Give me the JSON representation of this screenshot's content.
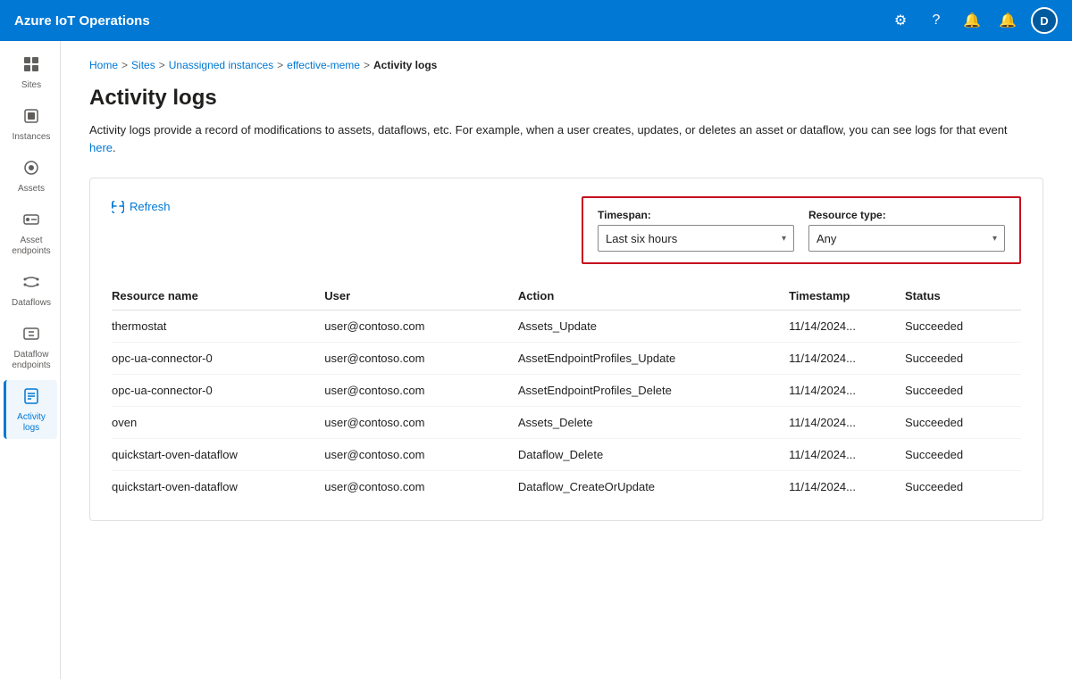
{
  "app": {
    "title": "Azure IoT Operations"
  },
  "topnav": {
    "title": "Azure IoT Operations",
    "avatar_label": "D"
  },
  "sidebar": {
    "items": [
      {
        "id": "sites",
        "label": "Sites",
        "icon": "⊞",
        "active": false
      },
      {
        "id": "instances",
        "label": "Instances",
        "icon": "⬡",
        "active": false
      },
      {
        "id": "assets",
        "label": "Assets",
        "icon": "◧",
        "active": false
      },
      {
        "id": "asset-endpoints",
        "label": "Asset endpoints",
        "icon": "⬡",
        "active": false
      },
      {
        "id": "dataflows",
        "label": "Dataflows",
        "icon": "⇄",
        "active": false
      },
      {
        "id": "dataflow-endpoints",
        "label": "Dataflow endpoints",
        "icon": "⊡",
        "active": false
      },
      {
        "id": "activity-logs",
        "label": "Activity logs",
        "icon": "📋",
        "active": true
      }
    ]
  },
  "breadcrumb": {
    "items": [
      {
        "label": "Home",
        "link": true
      },
      {
        "label": "Sites",
        "link": true
      },
      {
        "label": "Unassigned instances",
        "link": true
      },
      {
        "label": "effective-meme",
        "link": true
      },
      {
        "label": "Activity logs",
        "link": false
      }
    ]
  },
  "page": {
    "title": "Activity logs",
    "description": "Activity logs provide a record of modifications to assets, dataflows, etc. For example, when a user creates, updates, or deletes an asset or dataflow, you can see logs for that event here.",
    "description_link": "here"
  },
  "toolbar": {
    "refresh_label": "Refresh"
  },
  "filters": {
    "timespan_label": "Timespan:",
    "timespan_value": "Last six hours",
    "resource_type_label": "Resource type:",
    "resource_type_value": "Any"
  },
  "table": {
    "columns": [
      {
        "id": "resource_name",
        "label": "Resource name"
      },
      {
        "id": "user",
        "label": "User"
      },
      {
        "id": "action",
        "label": "Action"
      },
      {
        "id": "timestamp",
        "label": "Timestamp"
      },
      {
        "id": "status",
        "label": "Status"
      }
    ],
    "rows": [
      {
        "resource_name": "thermostat",
        "user": "user@contoso.com",
        "action": "Assets_Update",
        "timestamp": "11/14/2024...",
        "status": "Succeeded"
      },
      {
        "resource_name": "opc-ua-connector-0",
        "user": "user@contoso.com",
        "action": "AssetEndpointProfiles_Update",
        "timestamp": "11/14/2024...",
        "status": "Succeeded"
      },
      {
        "resource_name": "opc-ua-connector-0",
        "user": "user@contoso.com",
        "action": "AssetEndpointProfiles_Delete",
        "timestamp": "11/14/2024...",
        "status": "Succeeded"
      },
      {
        "resource_name": "oven",
        "user": "user@contoso.com",
        "action": "Assets_Delete",
        "timestamp": "11/14/2024...",
        "status": "Succeeded"
      },
      {
        "resource_name": "quickstart-oven-dataflow",
        "user": "user@contoso.com",
        "action": "Dataflow_Delete",
        "timestamp": "11/14/2024...",
        "status": "Succeeded"
      },
      {
        "resource_name": "quickstart-oven-dataflow",
        "user": "user@contoso.com",
        "action": "Dataflow_CreateOrUpdate",
        "timestamp": "11/14/2024...",
        "status": "Succeeded"
      }
    ]
  }
}
